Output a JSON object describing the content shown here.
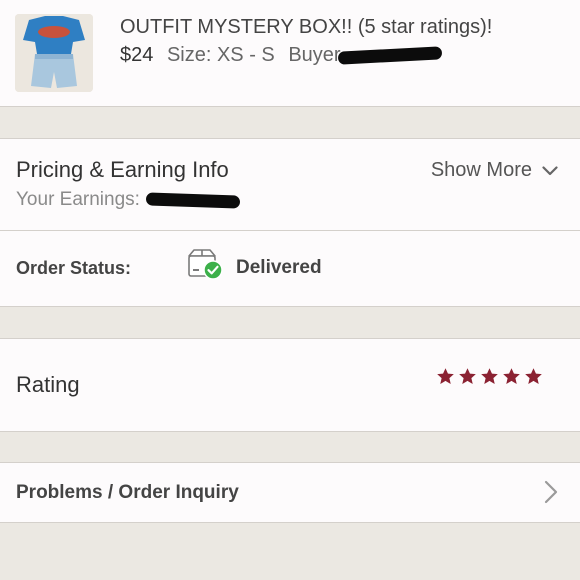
{
  "listing": {
    "title": "OUTFIT MYSTERY BOX!! (5 star ratings)!",
    "price": "$24",
    "size": "Size: XS - S",
    "buyer_label": "Buyer"
  },
  "pricing": {
    "title": "Pricing & Earning Info",
    "earnings_label": "Your Earnings:",
    "show_more": "Show More"
  },
  "order_status": {
    "label": "Order Status:",
    "value": "Delivered",
    "icon": "delivered-box-check-icon",
    "icon_accent": "#3cb04a"
  },
  "rating": {
    "label": "Rating",
    "stars": 5,
    "star_color": "#8b2232"
  },
  "problems": {
    "label": "Problems / Order Inquiry"
  },
  "colors": {
    "background": "#ebe8e2",
    "card": "#fdfbfc",
    "text": "#444444"
  }
}
